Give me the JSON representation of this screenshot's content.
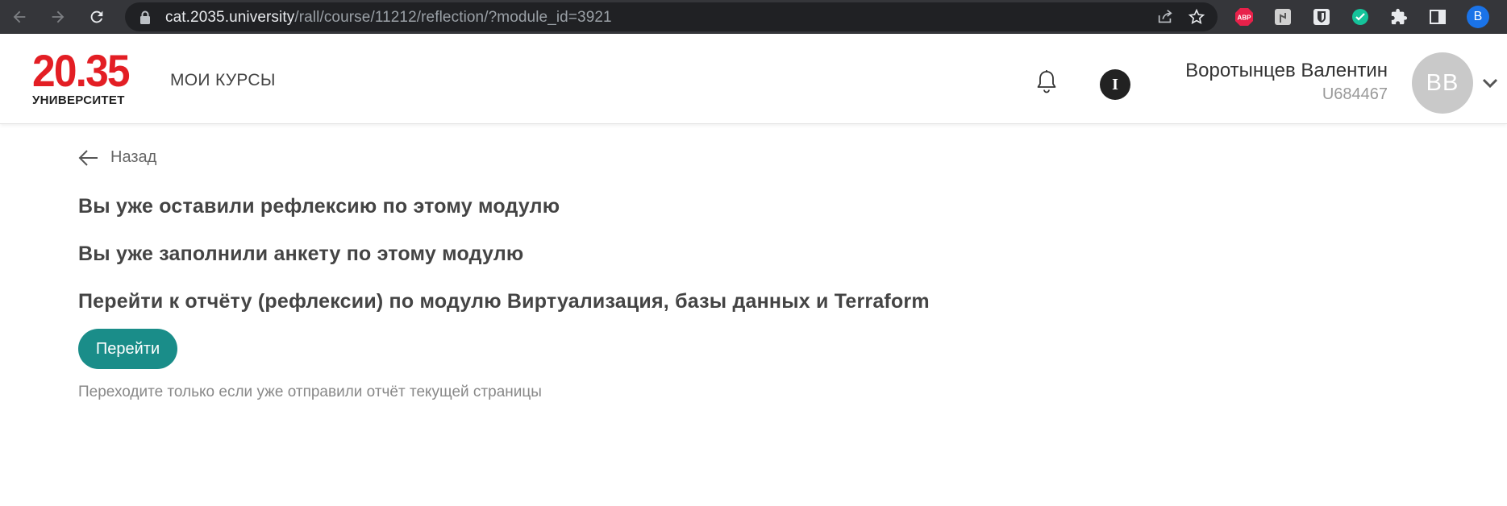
{
  "browser": {
    "url_host": "cat.2035.university",
    "url_path": "/rall/course/11212/reflection/?module_id=3921",
    "profile_initial": "B",
    "abp_label": "ABP"
  },
  "header": {
    "logo_number": "20.35",
    "logo_sub": "УНИВЕРСИТЕТ",
    "nav_courses": "МОИ КУРСЫ",
    "info_letter": "I",
    "user_name": "Воротынцев Валентин",
    "user_id": "U684467",
    "avatar_initials": "ВВ"
  },
  "content": {
    "back_label": "Назад",
    "message_reflection": "Вы уже оставили рефлексию по этому модулю",
    "message_survey": "Вы уже заполнили анкету по этому модулю",
    "message_goto": "Перейти к отчёту (рефлексии) по модулю Виртуализация, базы данных и Terraform",
    "go_button": "Перейти",
    "hint": "Переходите только если уже отправили отчёт текущей страницы"
  },
  "colors": {
    "brand_red": "#e31e24",
    "button_teal": "#1a8d89",
    "chrome_bg": "#35363a"
  }
}
